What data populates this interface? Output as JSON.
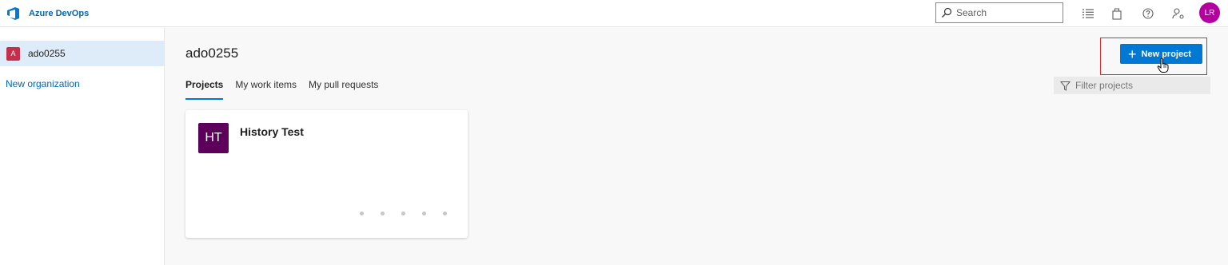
{
  "header": {
    "brand": "Azure DevOps",
    "search_placeholder": "Search",
    "icons": [
      "list-icon",
      "shopping-bag-icon",
      "help-icon",
      "user-settings-icon"
    ],
    "avatar_initials": "LR",
    "avatar_color": "#b4009e"
  },
  "sidebar": {
    "org": {
      "badge": "A",
      "label": "ado0255",
      "badge_color": "#c62f4b"
    },
    "new_org": "New organization"
  },
  "main": {
    "title": "ado0255",
    "tabs": [
      {
        "label": "Projects",
        "active": true
      },
      {
        "label": "My work items",
        "active": false
      },
      {
        "label": "My pull requests",
        "active": false
      }
    ],
    "new_project_label": "New project",
    "filter_placeholder": "Filter projects",
    "projects": [
      {
        "initials": "HT",
        "name": "History Test",
        "color": "#5c005c"
      }
    ]
  },
  "colors": {
    "accent": "#0078d4",
    "brand": "#0066b8",
    "highlight": "#e8272b"
  }
}
